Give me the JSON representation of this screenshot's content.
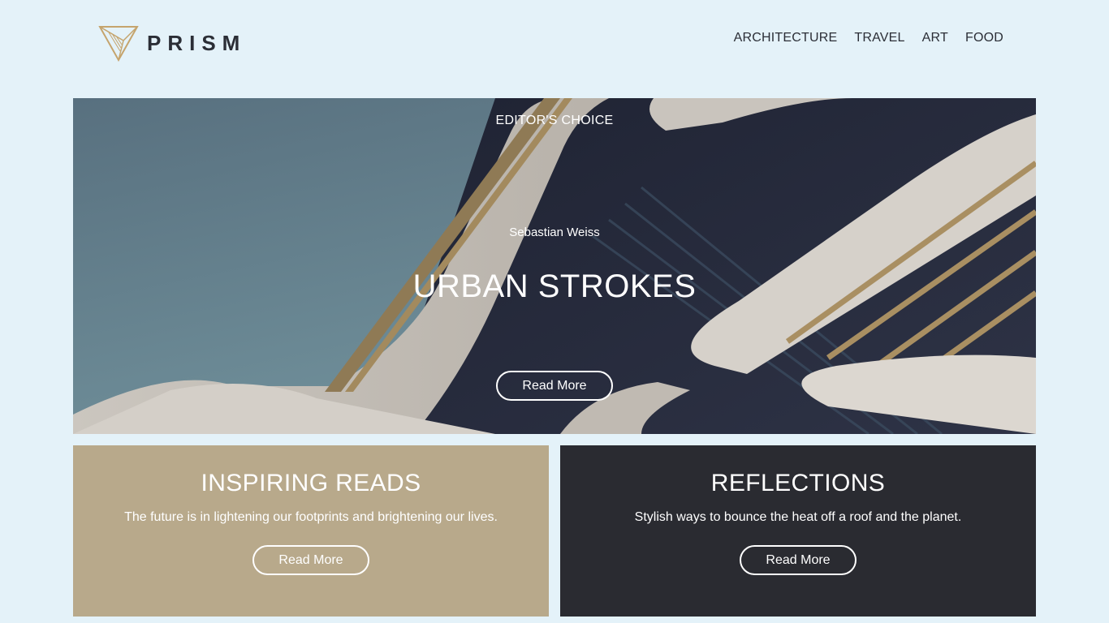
{
  "brand": {
    "name": "PRISM",
    "accent_color": "#c5a46d",
    "text_color": "#2b2e36"
  },
  "nav": [
    {
      "label": "ARCHITECTURE"
    },
    {
      "label": "TRAVEL"
    },
    {
      "label": "ART"
    },
    {
      "label": "FOOD"
    }
  ],
  "hero": {
    "kicker": "EDITOR'S CHOICE",
    "author": "Sebastian Weiss",
    "title": "URBAN STROKES",
    "button_label": "Read More",
    "image_icon": "architecture-photo"
  },
  "cards": [
    {
      "title": "INSPIRING READS",
      "text": "The future is in lightening our footprints and brightening our lives.",
      "button_label": "Read More",
      "background": "#b8a98b"
    },
    {
      "title": "REFLECTIONS",
      "text": "Stylish ways to bounce the heat off a roof and the planet.",
      "button_label": "Read More",
      "background": "#2a2b31"
    }
  ],
  "colors": {
    "page_background": "#e4f2f9"
  }
}
